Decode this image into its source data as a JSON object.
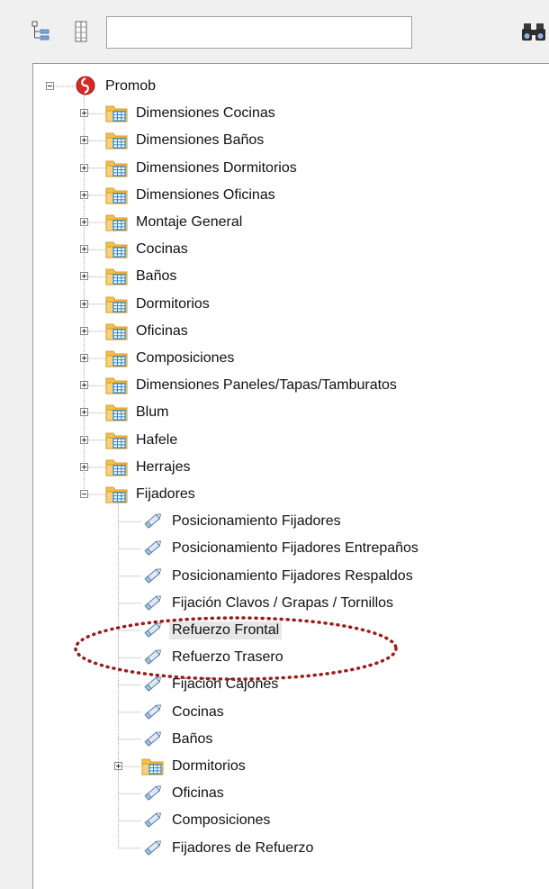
{
  "toolbar": {
    "search_value": "",
    "icons": [
      "tree-view-icon",
      "column-view-icon",
      "binoculars-icon"
    ]
  },
  "tree": {
    "root": {
      "label": "Promob",
      "icon": "promob-logo-icon",
      "expanded": true
    },
    "categories": [
      {
        "label": "Dimensiones Cocinas",
        "expanded": false
      },
      {
        "label": "Dimensiones Baños",
        "expanded": false
      },
      {
        "label": "Dimensiones Dormitorios",
        "expanded": false
      },
      {
        "label": "Dimensiones Oficinas",
        "expanded": false
      },
      {
        "label": "Montaje General",
        "expanded": false
      },
      {
        "label": "Cocinas",
        "expanded": false
      },
      {
        "label": "Baños",
        "expanded": false
      },
      {
        "label": "Dormitorios",
        "expanded": false
      },
      {
        "label": "Oficinas",
        "expanded": false
      },
      {
        "label": "Composiciones",
        "expanded": false
      },
      {
        "label": "Dimensiones Paneles/Tapas/Tamburatos",
        "expanded": false
      },
      {
        "label": "Blum",
        "expanded": false
      },
      {
        "label": "Hafele",
        "expanded": false
      },
      {
        "label": "Herrajes",
        "expanded": false
      },
      {
        "label": "Fijadores",
        "expanded": true
      }
    ],
    "fijadores_children": [
      {
        "label": "Posicionamiento Fijadores",
        "type": "item"
      },
      {
        "label": "Posicionamiento Fijadores Entrepaños",
        "type": "item"
      },
      {
        "label": "Posicionamiento Fijadores Respaldos",
        "type": "item"
      },
      {
        "label": "Fijación Clavos / Grapas / Tornillos",
        "type": "item"
      },
      {
        "label": "Refuerzo Frontal",
        "type": "item",
        "selected": true
      },
      {
        "label": "Refuerzo Trasero",
        "type": "item"
      },
      {
        "label": "Fijación Cajones",
        "type": "item"
      },
      {
        "label": "Cocinas",
        "type": "item"
      },
      {
        "label": "Baños",
        "type": "item"
      },
      {
        "label": "Dormitorios",
        "type": "folder",
        "expanded": false
      },
      {
        "label": "Oficinas",
        "type": "item"
      },
      {
        "label": "Composiciones",
        "type": "item"
      },
      {
        "label": "Fijadores de Refuerzo",
        "type": "item"
      }
    ]
  },
  "annotation": {
    "shape": "dotted-ellipse",
    "color": "#9b1c1c",
    "encloses": [
      "Refuerzo Frontal",
      "Refuerzo Trasero"
    ]
  },
  "colors": {
    "folder": "#f2c14e",
    "folder_dark": "#d99a1e",
    "grid_blue": "#2f86c9",
    "pencil_blue": "#5b7fa8",
    "root_red": "#d42a2a"
  }
}
